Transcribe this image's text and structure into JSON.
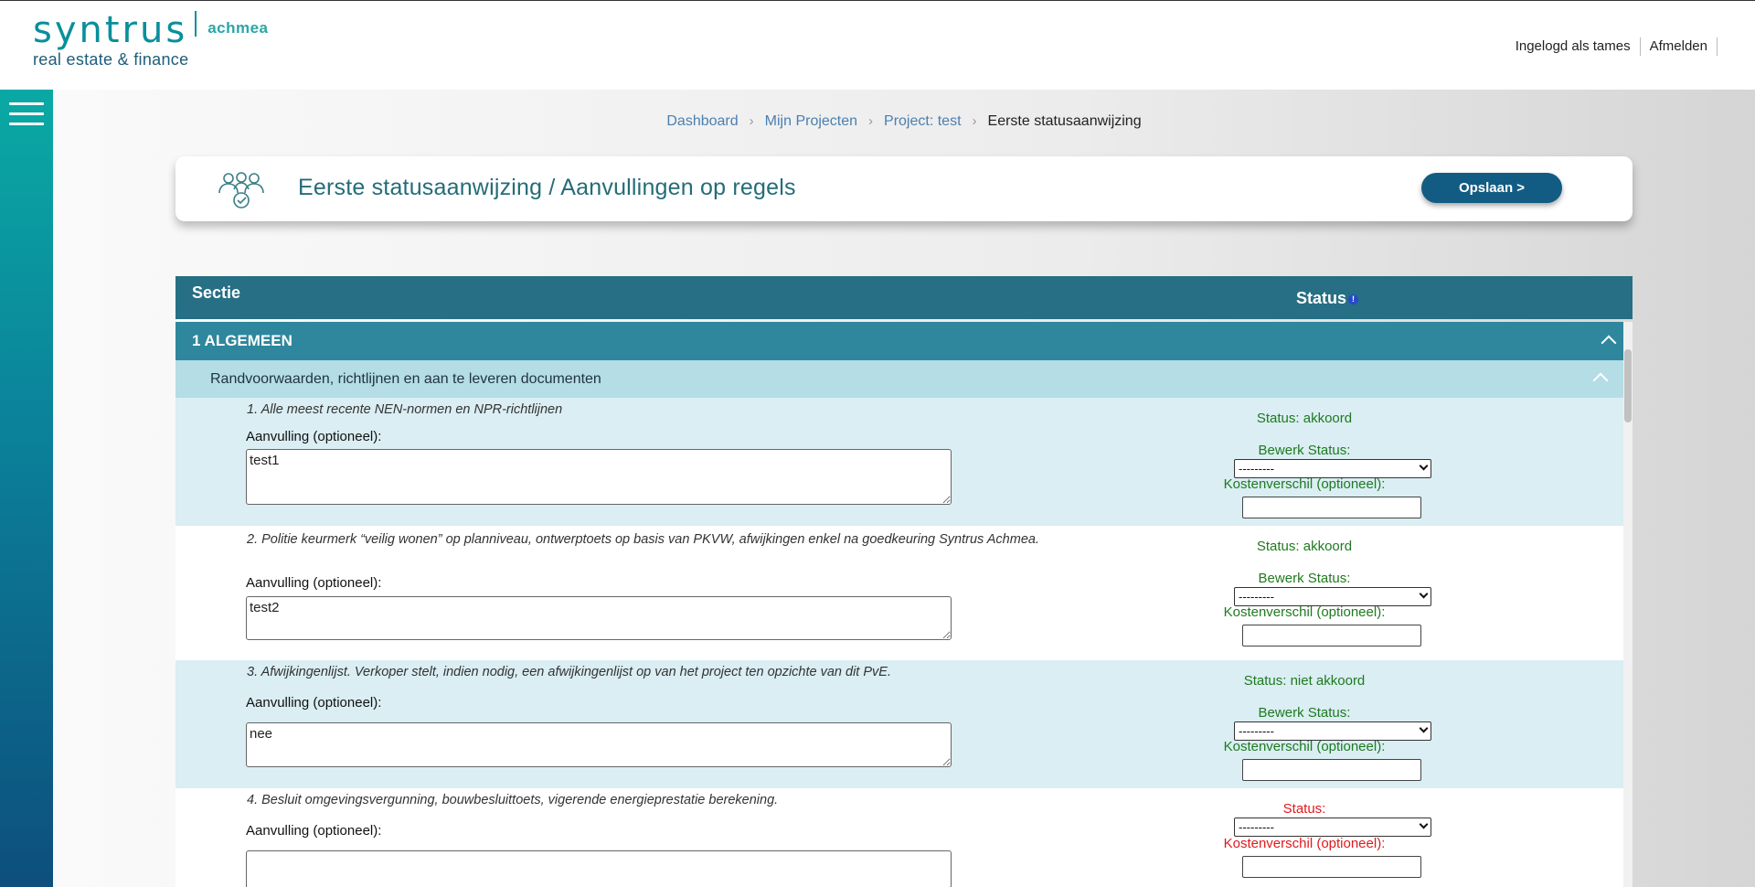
{
  "brand": {
    "name": "syntrus",
    "sub": "achmea",
    "tagline": "real estate & finance"
  },
  "user_nav": {
    "logged_in": "Ingelogd als tames",
    "logout": "Afmelden"
  },
  "breadcrumb": {
    "items": [
      "Dashboard",
      "Mijn Projecten",
      "Project: test"
    ],
    "current": "Eerste statusaanwijzing"
  },
  "header_card": {
    "title": "Eerste statusaanwijzing / Aanvullingen op regels",
    "save_label": "Opslaan >"
  },
  "table": {
    "col_section": "Sectie",
    "col_status": "Status",
    "info_mark": "!"
  },
  "section": {
    "title": "1 ALGEMEEN",
    "subsection": "Randvoorwaarden, richtlijnen en aan te leveren documenten"
  },
  "rows": [
    {
      "question": "1. Alle meest recente NEN-normen en NPR-richtlijnen",
      "aanvulling_label": "Aanvulling (optioneel):",
      "aanvulling_value": "test1",
      "status_text": "Status: akkoord",
      "edit_label": "Bewerk Status:",
      "select_value": "---------",
      "cost_label": "Kostenverschil (optioneel):"
    },
    {
      "question": "2. Politie keurmerk “veilig wonen” op planniveau, ontwerptoets op basis van PKVW, afwijkingen enkel na goedkeuring Syntrus Achmea.",
      "aanvulling_label": "Aanvulling (optioneel):",
      "aanvulling_value": "test2",
      "status_text": "Status: akkoord",
      "edit_label": "Bewerk Status:",
      "select_value": "---------",
      "cost_label": "Kostenverschil (optioneel):"
    },
    {
      "question": "3. Afwijkingenlijst. Verkoper stelt, indien nodig, een afwijkingenlijst op van het project ten opzichte van dit PvE.",
      "aanvulling_label": "Aanvulling (optioneel):",
      "aanvulling_value": "nee",
      "status_text": "Status: niet akkoord",
      "edit_label": "Bewerk Status:",
      "select_value": "---------",
      "cost_label": "Kostenverschil (optioneel):"
    },
    {
      "question": "4. Besluit omgevingsvergunning, bouwbesluittoets, vigerende energieprestatie berekening.",
      "aanvulling_label": "Aanvulling (optioneel):",
      "aanvulling_value": "",
      "status_text": "Status:",
      "select_value": "---------",
      "cost_label": "Kostenverschil (optioneel):"
    }
  ],
  "colors": {
    "teal_header": "#266f84",
    "section_bar": "#2e879c",
    "subsection_bar": "#b4dde6",
    "row_alt": "#daeef3",
    "status_green": "#1f7a1f",
    "status_red": "#e0191e",
    "save_button": "#125c83"
  },
  "icons": {
    "menu": "hamburger-icon",
    "card": "people-check-icon",
    "info": "info-icon",
    "collapse": "chevron-up-icon"
  }
}
